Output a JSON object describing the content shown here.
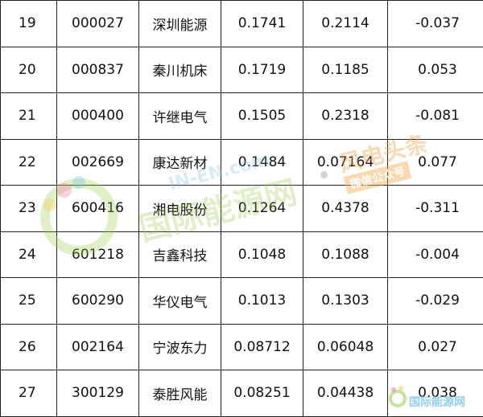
{
  "rows": [
    [
      "19",
      "000027",
      "深圳能源",
      "0.1741",
      "0.2114",
      "-0.037"
    ],
    [
      "20",
      "000837",
      "秦川机床",
      "0.1719",
      "0.1185",
      "0.053"
    ],
    [
      "21",
      "000400",
      "许继电气",
      "0.1505",
      "0.2318",
      "-0.081"
    ],
    [
      "22",
      "002669",
      "康达新材",
      "0.1484",
      "0.07164",
      "0.077"
    ],
    [
      "23",
      "600416",
      "湘电股份",
      "0.1264",
      "0.4378",
      "-0.311"
    ],
    [
      "24",
      "601218",
      "吉鑫科技",
      "0.1048",
      "0.1088",
      "-0.004"
    ],
    [
      "25",
      "600290",
      "华仪电气",
      "0.1013",
      "0.1303",
      "-0.029"
    ],
    [
      "26",
      "002164",
      "宁波东力",
      "0.08712",
      "0.06048",
      "0.027"
    ],
    [
      "27",
      "300129",
      "泰胜风能",
      "0.08251",
      "0.04438",
      "0.038"
    ]
  ],
  "watermark": {
    "logo_en": "IN-EN.com",
    "logo_cn": "国际能源网",
    "right_title": "风电头条",
    "right_sub": "微信公众号",
    "corner": "国际能源网"
  }
}
